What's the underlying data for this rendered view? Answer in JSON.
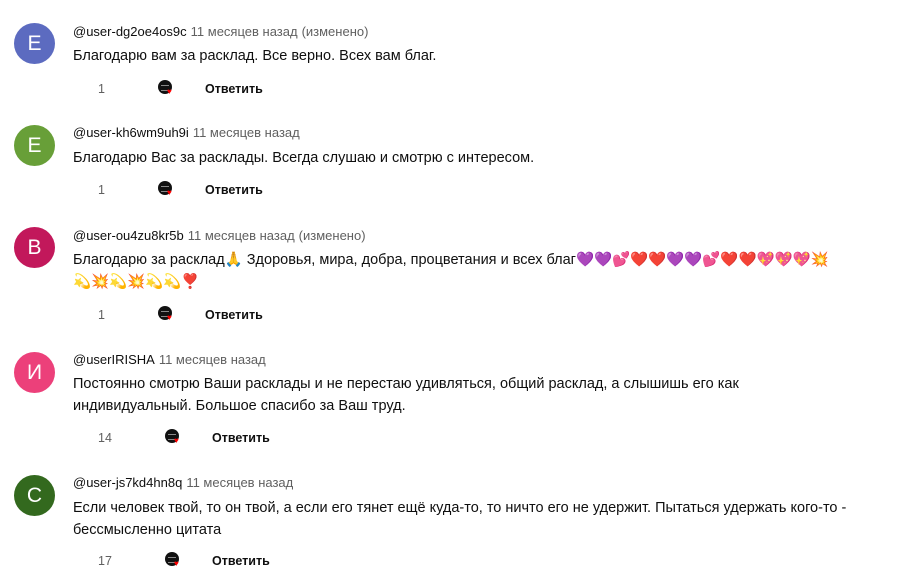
{
  "comments": [
    {
      "avatar_letter": "E",
      "avatar_color": "#5c6bc0",
      "author": "@user-dg2oe4os9c",
      "time": "11 месяцев назад",
      "edited": "(изменено)",
      "lines": [
        "Благодарю вам за расклад. Все верно. Всех вам благ."
      ],
      "likes": "1",
      "reply_label": "Ответить"
    },
    {
      "avatar_letter": "E",
      "avatar_color": "#689f38",
      "author": "@user-kh6wm9uh9i",
      "time": "11 месяцев назад",
      "edited": "",
      "lines": [
        "Благодарю Вас за расклады. Всегда слушаю и смотрю с интересом."
      ],
      "likes": "1",
      "reply_label": "Ответить"
    },
    {
      "avatar_letter": "B",
      "avatar_color": "#c2185b",
      "author": "@user-ou4zu8kr5b",
      "time": "11 месяцев назад",
      "edited": "(изменено)",
      "lines": [
        "Благодарю за расклад🙏 Здоровья, мира, добра, процветания и всех благ💜💜💕❤️❤️💜💜💕❤️❤️💖💖💖💥",
        "💫💥💫💥💫💫❣️"
      ],
      "likes": "1",
      "reply_label": "Ответить"
    },
    {
      "avatar_letter": "И",
      "avatar_color": "#ec407a",
      "author": "@userIRISHA",
      "time": "11 месяцев назад",
      "edited": "",
      "lines": [
        "Постоянно смотрю Ваши расклады и не перестаю удивляться, общий расклад, а слышишь его как",
        "индивидуальный. Большое спасибо за Ваш труд."
      ],
      "likes": "14",
      "reply_label": "Ответить"
    },
    {
      "avatar_letter": "С",
      "avatar_color": "#33691e",
      "author": "@user-js7kd4hn8q",
      "time": "11 месяцев назад",
      "edited": "",
      "lines": [
        "Если человек твой, то он твой, а если его тянет ещё  куда-то,  то ничто его не удержит. Пытаться удержать  кого-то   -",
        "бессмысленно цитата"
      ],
      "likes": "17",
      "reply_label": "Ответить"
    }
  ]
}
